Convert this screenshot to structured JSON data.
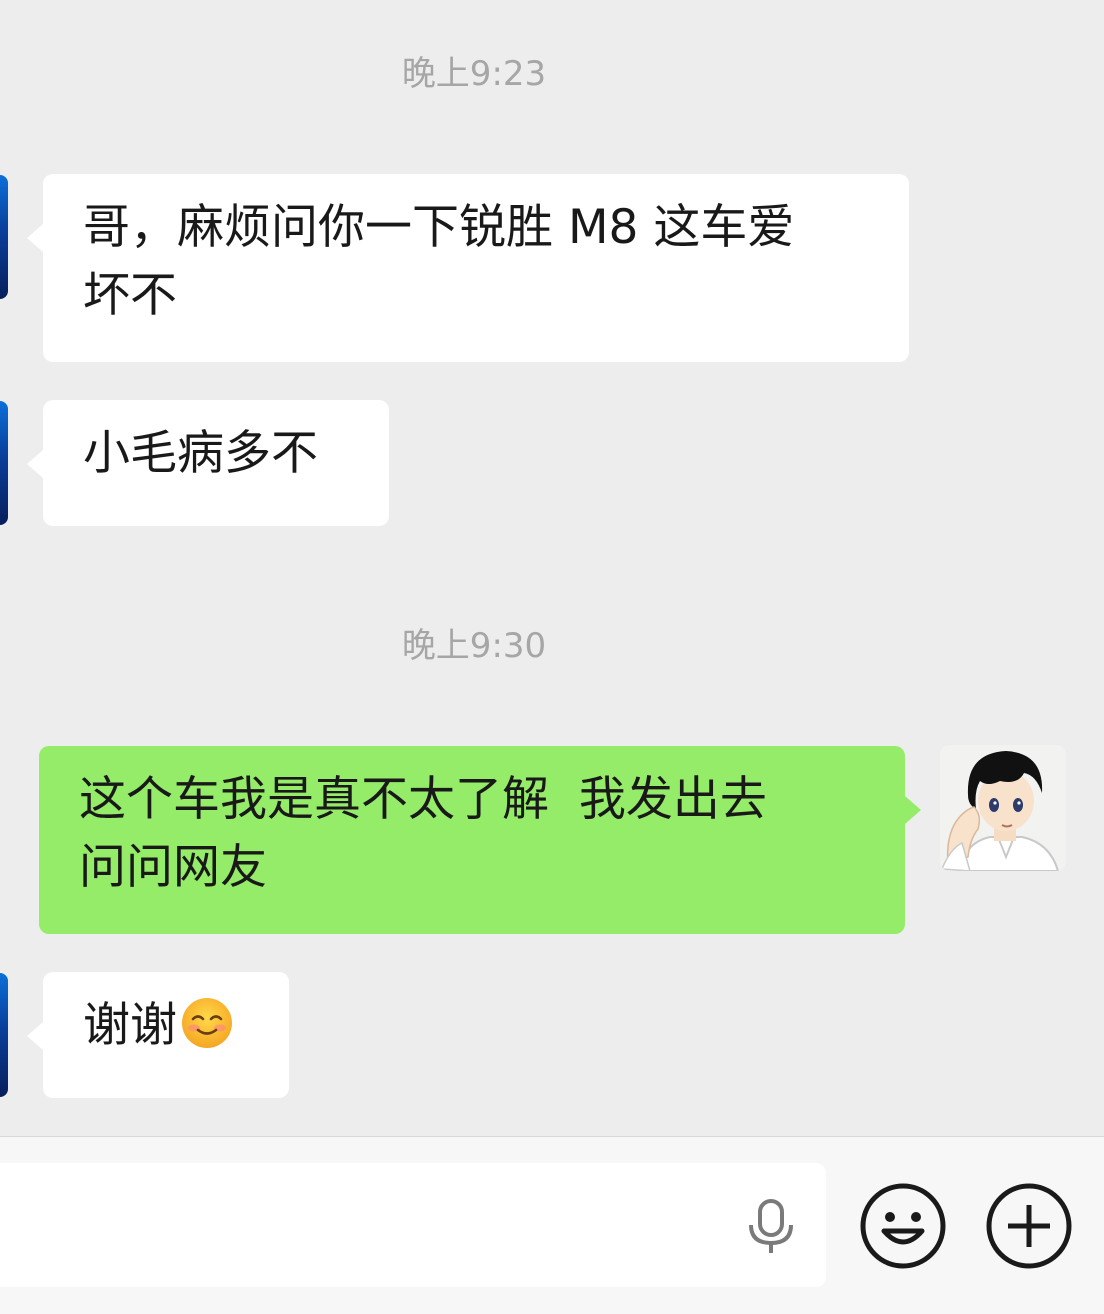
{
  "timestamps": [
    "晚上9:23",
    "晚上9:30"
  ],
  "messages": [
    {
      "sender": "peer",
      "line1": "哥，麻烦问你一下锐胜 M8 这车爱",
      "line2": "坏不"
    },
    {
      "sender": "peer",
      "text": "小毛病多不"
    },
    {
      "sender": "self",
      "line1": "这个车我是真不太了解  我发出去",
      "line2": "问问网友"
    },
    {
      "sender": "peer",
      "text": "谢谢",
      "emoji": "smiling-face-emoji"
    }
  ],
  "input_bar": {
    "placeholder": "",
    "icons": [
      "microphone-icon",
      "emoji-face-icon",
      "plus-icon"
    ]
  },
  "colors": {
    "background": "#ededed",
    "incoming_bubble": "#ffffff",
    "outgoing_bubble": "#95ec69",
    "timestamp_text": "#a6a6a6"
  }
}
